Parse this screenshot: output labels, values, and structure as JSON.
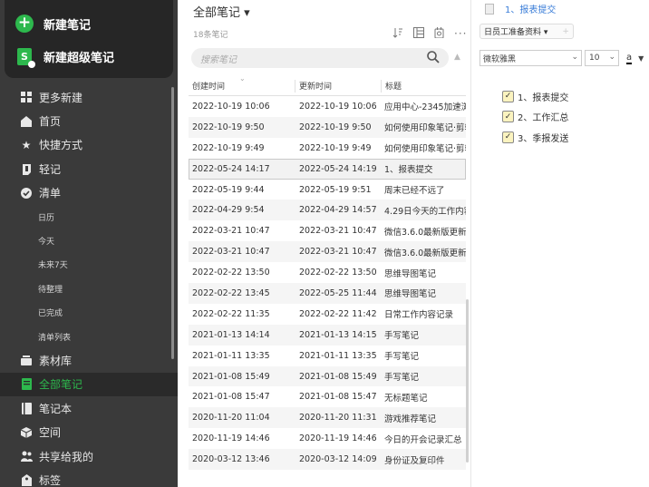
{
  "colors": {
    "accent": "#2db84d",
    "sidebar_bg": "#3a3a3a",
    "link": "#3a7dd8"
  },
  "sidebar": {
    "new_note": "新建笔记",
    "new_super_note": "新建超级笔记",
    "items": [
      {
        "label": "更多新建",
        "icon": "grid-icon"
      },
      {
        "label": "首页",
        "icon": "home-icon"
      },
      {
        "label": "快捷方式",
        "icon": "star-icon"
      },
      {
        "label": "轻记",
        "icon": "quick-note-icon"
      },
      {
        "label": "清单",
        "icon": "check-circle-icon"
      },
      {
        "label": "日历",
        "sub": true
      },
      {
        "label": "今天",
        "sub": true
      },
      {
        "label": "未来7天",
        "sub": true
      },
      {
        "label": "待整理",
        "sub": true
      },
      {
        "label": "已完成",
        "sub": true
      },
      {
        "label": "清单列表",
        "sub": true
      },
      {
        "label": "素材库",
        "icon": "library-icon"
      },
      {
        "label": "全部笔记",
        "icon": "all-notes-icon",
        "active": true
      },
      {
        "label": "笔记本",
        "icon": "notebook-icon"
      },
      {
        "label": "空间",
        "icon": "space-icon"
      },
      {
        "label": "共享给我的",
        "icon": "shared-icon"
      },
      {
        "label": "标签",
        "icon": "tag-icon"
      }
    ]
  },
  "list": {
    "title": "全部笔记 ▾",
    "count": "18条笔记",
    "search_placeholder": "搜索笔记",
    "headers": [
      "创建时间",
      "更新时间",
      "标题"
    ],
    "rows": [
      [
        "2022-10-19 10:06",
        "2022-10-19 10:06",
        "应用中心-2345加速浏"
      ],
      [
        "2022-10-19 9:50",
        "2022-10-19 9:50",
        "如何使用印象笔记·剪辑"
      ],
      [
        "2022-10-19 9:49",
        "2022-10-19 9:49",
        "如何使用印象笔记·剪辑"
      ],
      [
        "2022-05-24 14:17",
        "2022-05-24 14:19",
        "1、报表提交"
      ],
      [
        "2022-05-19 9:44",
        "2022-05-19 9:51",
        "周末已经不远了"
      ],
      [
        "2022-04-29 9:54",
        "2022-04-29 14:57",
        "4.29日今天的工作内容"
      ],
      [
        "2022-03-21 10:47",
        "2022-03-21 10:47",
        "微信3.6.0最新版更新"
      ],
      [
        "2022-03-21 10:47",
        "2022-03-21 10:47",
        "微信3.6.0最新版更新"
      ],
      [
        "2022-02-22 13:50",
        "2022-02-22 13:50",
        "思维导图笔记"
      ],
      [
        "2022-02-22 13:45",
        "2022-05-25 11:44",
        "思维导图笔记"
      ],
      [
        "2022-02-22 11:35",
        "2022-02-22 11:42",
        "日常工作内容记录"
      ],
      [
        "2021-01-13 14:14",
        "2021-01-13 14:15",
        "手写笔记"
      ],
      [
        "2021-01-11 13:35",
        "2021-01-11 13:35",
        "手写笔记"
      ],
      [
        "2021-01-08 15:49",
        "2021-01-08 15:49",
        "手写笔记"
      ],
      [
        "2021-01-08 15:47",
        "2021-01-08 15:47",
        "无标题笔记"
      ],
      [
        "2020-11-20 11:04",
        "2020-11-20 11:31",
        "游戏推荐笔记"
      ],
      [
        "2020-11-19 14:46",
        "2020-11-19 14:46",
        "今日的开会记录汇总"
      ],
      [
        "2020-03-12 13:46",
        "2020-03-12 14:09",
        "身份证及复印件"
      ]
    ],
    "selected_index": 3
  },
  "detail": {
    "title": "1、报表提交",
    "template_button": "日员工准备资料 ▾",
    "template_add": "+",
    "font": "微软雅黑",
    "size": "10",
    "color_label": "a",
    "checklist": [
      {
        "label": "1、报表提交",
        "checked": true
      },
      {
        "label": "2、工作汇总",
        "checked": true
      },
      {
        "label": "3、季报发送",
        "checked": true
      }
    ]
  }
}
